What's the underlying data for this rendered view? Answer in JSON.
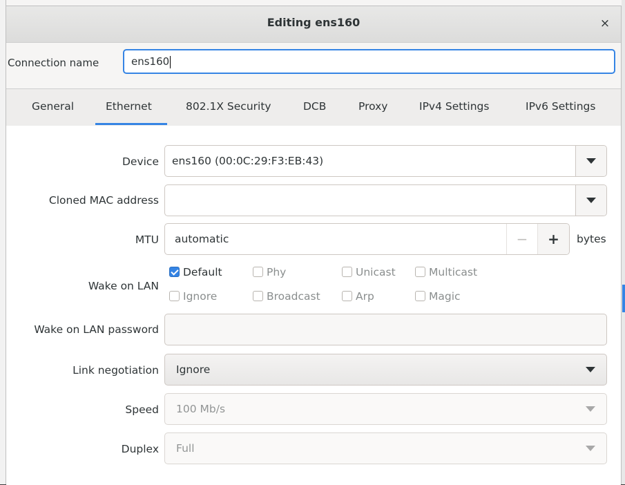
{
  "dialog": {
    "title": "Editing ens160",
    "close_glyph": "×"
  },
  "connection": {
    "label": "Connection name",
    "value": "ens160"
  },
  "tabs": [
    {
      "label": "General"
    },
    {
      "label": "Ethernet",
      "active": true
    },
    {
      "label": "802.1X Security"
    },
    {
      "label": "DCB"
    },
    {
      "label": "Proxy"
    },
    {
      "label": "IPv4 Settings"
    },
    {
      "label": "IPv6 Settings"
    }
  ],
  "ethernet": {
    "device_label": "Device",
    "device_value": "ens160 (00:0C:29:F3:EB:43)",
    "cloned_mac_label": "Cloned MAC address",
    "cloned_mac_value": "",
    "mtu_label": "MTU",
    "mtu_value": "automatic",
    "mtu_minus": "−",
    "mtu_plus": "+",
    "mtu_unit": "bytes",
    "wol_label": "Wake on LAN",
    "wol_options": [
      {
        "label": "Default",
        "checked": true,
        "enabled": true
      },
      {
        "label": "Phy",
        "checked": false,
        "enabled": false
      },
      {
        "label": "Unicast",
        "checked": false,
        "enabled": false
      },
      {
        "label": "Multicast",
        "checked": false,
        "enabled": false
      },
      {
        "label": "Ignore",
        "checked": false,
        "enabled": false
      },
      {
        "label": "Broadcast",
        "checked": false,
        "enabled": false
      },
      {
        "label": "Arp",
        "checked": false,
        "enabled": false
      },
      {
        "label": "Magic",
        "checked": false,
        "enabled": false
      }
    ],
    "wol_password_label": "Wake on LAN password",
    "wol_password_value": "",
    "link_negotiation_label": "Link negotiation",
    "link_negotiation_value": "Ignore",
    "speed_label": "Speed",
    "speed_value": "100 Mb/s",
    "duplex_label": "Duplex",
    "duplex_value": "Full"
  },
  "colors": {
    "accent": "#3584e4",
    "text": "#2e3436",
    "disabled_text": "#929595"
  },
  "icons": {
    "dropdown": "chevron-down-icon",
    "close": "close-icon",
    "check": "checkmark-icon"
  }
}
